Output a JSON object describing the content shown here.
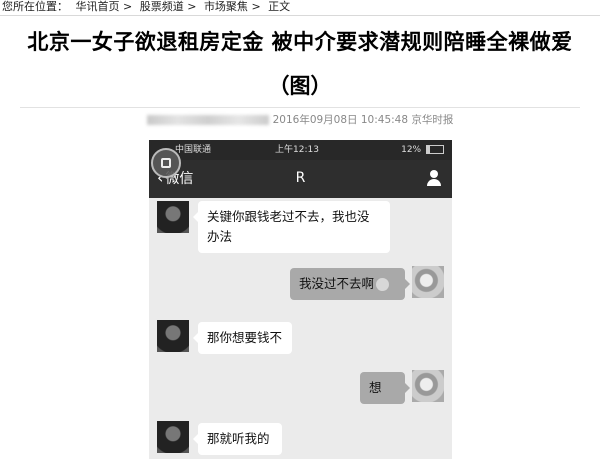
{
  "breadcrumb": {
    "prefix": "您所在位置：",
    "items": [
      "华讯首页",
      "股票频道",
      "市场聚焦",
      "正文"
    ],
    "separator": ">"
  },
  "article": {
    "title_line1": "北京一女子欲退租房定金 被中介要求潜规则陪睡全裸做爱",
    "title_line2": "（图）",
    "datetime": "2016年09月08日 10:45:48",
    "source": "京华时报"
  },
  "phone": {
    "status": {
      "carrier": "中国联通",
      "time": "上午12:13",
      "battery": "12%"
    },
    "nav": {
      "back_label": "微信",
      "chat_title": "R"
    },
    "messages": [
      {
        "side": "in",
        "lines": [
          "关键你跟钱老过不去，我也没",
          "办法"
        ]
      },
      {
        "side": "out",
        "lines": [
          "我没过不去啊"
        ]
      },
      {
        "side": "in",
        "lines": [
          "那你想要钱不"
        ]
      },
      {
        "side": "out",
        "lines": [
          "想"
        ]
      },
      {
        "side": "in",
        "lines": [
          "那就听我的"
        ]
      }
    ]
  }
}
